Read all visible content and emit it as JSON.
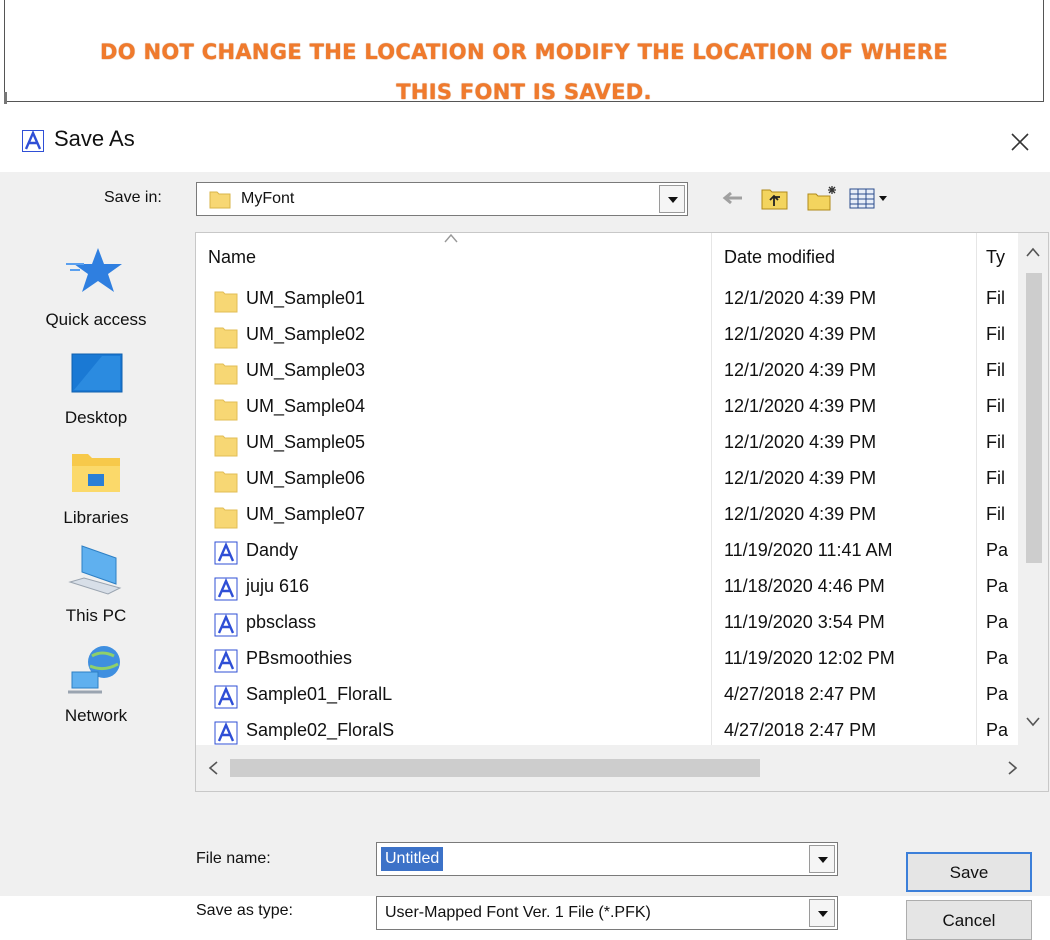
{
  "banner": {
    "line1": "DO NOT CHANGE THE LOCATION OR MODIFY THE LOCATION OF WHERE",
    "line2": "THIS FONT IS SAVED."
  },
  "dialog": {
    "title": "Save As",
    "close_symbol": "×",
    "save_in_label": "Save in:",
    "save_in_value": "MyFont",
    "toolbar": [
      "back-arrow-icon",
      "up-folder-icon",
      "new-folder-icon",
      "view-menu-icon"
    ]
  },
  "places": [
    {
      "label": "Quick access",
      "icon": "star-icon"
    },
    {
      "label": "Desktop",
      "icon": "desktop-icon"
    },
    {
      "label": "Libraries",
      "icon": "libraries-icon"
    },
    {
      "label": "This PC",
      "icon": "computer-icon"
    },
    {
      "label": "Network",
      "icon": "network-icon"
    }
  ],
  "columns": {
    "name": "Name",
    "date": "Date modified",
    "type": "Ty"
  },
  "files": [
    {
      "name": "UM_Sample01",
      "date": "12/1/2020 4:39 PM",
      "type": "Fil",
      "kind": "folder"
    },
    {
      "name": "UM_Sample02",
      "date": "12/1/2020 4:39 PM",
      "type": "Fil",
      "kind": "folder"
    },
    {
      "name": "UM_Sample03",
      "date": "12/1/2020 4:39 PM",
      "type": "Fil",
      "kind": "folder"
    },
    {
      "name": "UM_Sample04",
      "date": "12/1/2020 4:39 PM",
      "type": "Fil",
      "kind": "folder"
    },
    {
      "name": "UM_Sample05",
      "date": "12/1/2020 4:39 PM",
      "type": "Fil",
      "kind": "folder"
    },
    {
      "name": "UM_Sample06",
      "date": "12/1/2020 4:39 PM",
      "type": "Fil",
      "kind": "folder"
    },
    {
      "name": "UM_Sample07",
      "date": "12/1/2020 4:39 PM",
      "type": "Fil",
      "kind": "folder"
    },
    {
      "name": "Dandy",
      "date": "11/19/2020 11:41 AM",
      "type": "Pa",
      "kind": "font"
    },
    {
      "name": "juju 616",
      "date": "11/18/2020 4:46 PM",
      "type": "Pa",
      "kind": "font"
    },
    {
      "name": "pbsclass",
      "date": "11/19/2020 3:54 PM",
      "type": "Pa",
      "kind": "font"
    },
    {
      "name": "PBsmoothies",
      "date": "11/19/2020 12:02 PM",
      "type": "Pa",
      "kind": "font"
    },
    {
      "name": "Sample01_FloralL",
      "date": "4/27/2018 2:47 PM",
      "type": "Pa",
      "kind": "font"
    },
    {
      "name": "Sample02_FloralS",
      "date": "4/27/2018 2:47 PM",
      "type": "Pa",
      "kind": "font"
    }
  ],
  "form": {
    "file_name_label": "File name:",
    "file_name_value": "Untitled",
    "save_type_label": "Save as type:",
    "save_type_value": "User-Mapped Font Ver. 1 File (*.PFK)"
  },
  "buttons": {
    "save": "Save",
    "cancel": "Cancel"
  },
  "colors": {
    "banner_text": "#f07a2c",
    "selection": "#3c72c8",
    "folder": "#f7d774",
    "app_icon": "#2f4fd6"
  }
}
